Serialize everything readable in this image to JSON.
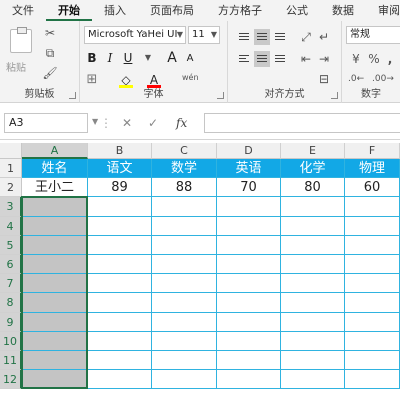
{
  "tabs": [
    "文件",
    "开始",
    "插入",
    "页面布局",
    "方方格子",
    "公式",
    "数据",
    "审阅"
  ],
  "active_tab": "开始",
  "ribbon": {
    "clipboard": {
      "paste_label": "粘贴",
      "group_label": "剪贴板"
    },
    "font": {
      "font_name": "Microsoft YaHei UI",
      "font_size": "11",
      "bold": "B",
      "italic": "I",
      "underline": "U",
      "grow": "A",
      "shrink": "A",
      "font_color_label": "A",
      "font_color": "#ff0000",
      "highlight_color": "#ffff00",
      "wen": "wén",
      "group_label": "字体"
    },
    "alignment": {
      "group_label": "对齐方式"
    },
    "number": {
      "format": "常规",
      "percent": "%",
      "comma": ",",
      "group_label": "数字"
    }
  },
  "formula_bar": {
    "name_box": "A3",
    "cancel": "✕",
    "enter": "✓",
    "fx": "fx",
    "value": ""
  },
  "columns": [
    "A",
    "B",
    "C",
    "D",
    "E",
    "F"
  ],
  "rows": [
    "1",
    "2",
    "3",
    "4",
    "5",
    "6",
    "7",
    "8",
    "9",
    "10",
    "11",
    "12"
  ],
  "table": {
    "headers": [
      "姓名",
      "语文",
      "数学",
      "英语",
      "化学",
      "物理"
    ],
    "values": [
      "王小二",
      "89",
      "88",
      "70",
      "80",
      "60"
    ]
  },
  "selection": {
    "cell": "A3",
    "range": "A3:A12"
  },
  "colors": {
    "header_fill": "#12a8e6",
    "grid_line": "#2fb3e0",
    "accent": "#217346",
    "selected_fill": "#c4c4c4"
  }
}
